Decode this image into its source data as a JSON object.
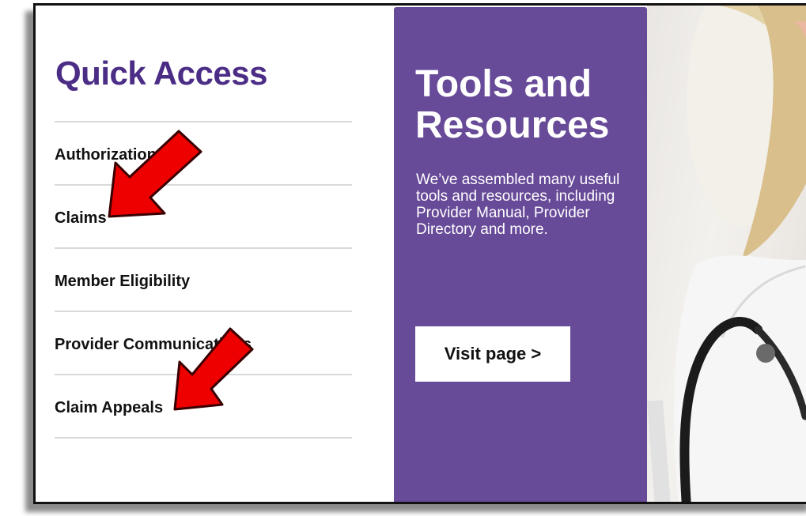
{
  "quick_access": {
    "title": "Quick Access",
    "items": [
      {
        "label": "Authorizations"
      },
      {
        "label": "Claims"
      },
      {
        "label": "Member Eligibility"
      },
      {
        "label": "Provider Communications"
      },
      {
        "label": "Claim Appeals"
      }
    ]
  },
  "promo": {
    "title": "Tools and Resources",
    "description": "We’ve assembled many useful tools and resources, including Provider Manual, Provider Directory and more.",
    "button_label": "Visit page >"
  },
  "colors": {
    "title_purple": "#4b2d85",
    "promo_background": "#674a98",
    "annotation_arrow": "#ee0000"
  },
  "annotations": [
    {
      "icon": "red-arrow-icon",
      "points_to": "Claims"
    },
    {
      "icon": "red-arrow-icon",
      "points_to": "Claim Appeals"
    }
  ]
}
